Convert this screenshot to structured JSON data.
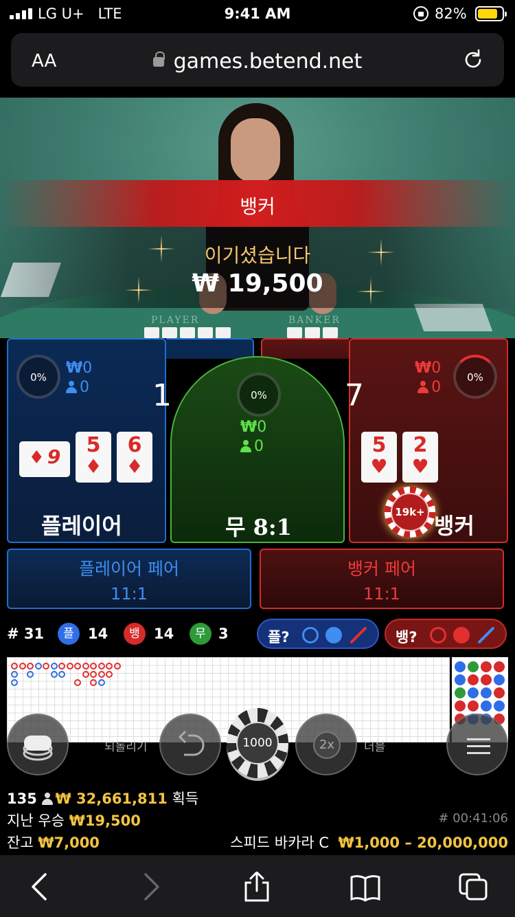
{
  "status_bar": {
    "carrier": "LG U+",
    "network": "LTE",
    "time": "9:41 AM",
    "battery": "82%"
  },
  "browser": {
    "text_size_label": "AA",
    "url": "games.betend.net"
  },
  "result": {
    "winner": "뱅커",
    "message": "이기셨습니다",
    "amount": "₩ 19,500"
  },
  "felt_labels": {
    "player": "PLAYER",
    "banker": "BANKER"
  },
  "player": {
    "percent": "0%",
    "currency": "₩",
    "bet": "0",
    "users": "0",
    "score": "1",
    "cards": [
      {
        "rank": "9",
        "suit": "♦",
        "rotated": true
      },
      {
        "rank": "5",
        "suit": "♦"
      },
      {
        "rank": "6",
        "suit": "♦"
      }
    ],
    "label": "플레이어"
  },
  "tie": {
    "percent": "0%",
    "currency": "₩",
    "bet": "0",
    "users": "0",
    "label": "무",
    "odds": "8:1"
  },
  "banker": {
    "percent": "0%",
    "currency": "₩",
    "bet": "0",
    "users": "0",
    "score": "7",
    "cards": [
      {
        "rank": "5",
        "suit": "♥"
      },
      {
        "rank": "2",
        "suit": "♥"
      }
    ],
    "label": "뱅커",
    "chip": "19k+"
  },
  "pairs": {
    "player": {
      "label": "플레이어 페어",
      "odds": "11:1"
    },
    "banker": {
      "label": "뱅커 페어",
      "odds": "11:1"
    }
  },
  "counts": {
    "round": "# 31",
    "player_badge": "플",
    "player": "14",
    "banker_badge": "뱅",
    "banker": "14",
    "tie_badge": "무",
    "tie": "3",
    "predict_player": "플?",
    "predict_banker": "뱅?"
  },
  "controls": {
    "undo": "되돌리기",
    "chip": "1000",
    "double": "2x",
    "double_label": "더블"
  },
  "info": {
    "players": "135",
    "total_won": "₩ 32,661,811",
    "won_suffix": "획득",
    "last_win_label": "지난 우승",
    "last_win": "₩19,500",
    "game_id": "# 00:41:06",
    "balance_label": "잔고",
    "balance": "₩7,000",
    "table_name": "스피드 바카라 C",
    "limits": "₩1,000 – 20,000,000"
  },
  "colors": {
    "player": "#1e6fd1",
    "banker": "#d52b2b",
    "tie": "#49b23b",
    "gold": "#f3c442"
  },
  "icons": [
    "signal-icon",
    "orientation-lock-icon",
    "battery-icon",
    "lock-icon",
    "reload-icon",
    "person-icon",
    "chips-stack-icon",
    "undo-icon",
    "back-icon",
    "forward-icon",
    "share-icon",
    "bookmarks-icon",
    "tabs-icon",
    "menu-icon"
  ]
}
